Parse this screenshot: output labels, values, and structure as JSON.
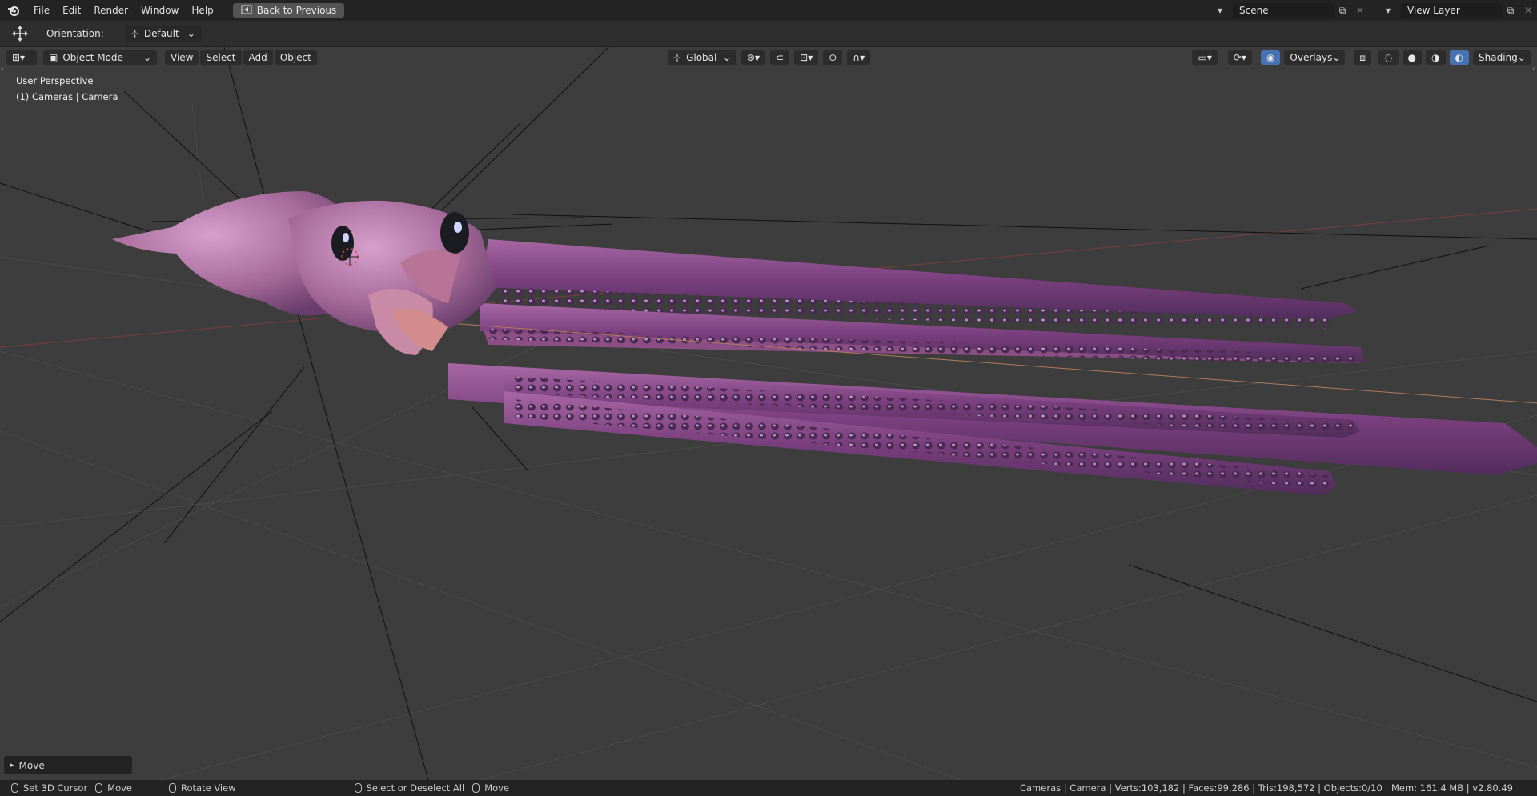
{
  "menu": [
    "File",
    "Edit",
    "Render",
    "Window",
    "Help"
  ],
  "back_button": "Back to Previous",
  "scene": {
    "label": "Scene",
    "view_layer": "View Layer"
  },
  "tool_settings": {
    "orientation_label": "Orientation:",
    "orientation_value": "Default"
  },
  "viewport_header": {
    "mode": "Object Mode",
    "menus": [
      "View",
      "Select",
      "Add",
      "Object"
    ],
    "transform_orientation": "Global",
    "overlays": "Overlays",
    "shading": "Shading"
  },
  "viewport": {
    "perspective": "User Perspective",
    "context": "(1) Cameras | Camera"
  },
  "last_operator": "Move",
  "status": {
    "left": [
      "Set 3D Cursor",
      "Move",
      "Rotate View",
      "Select or Deselect All",
      "Move"
    ],
    "stats": "Cameras | Camera | Verts:103,182 | Faces:99,286 | Tris:198,572 | Objects:0/10 | Mem: 161.4 MB | v2.80.49"
  },
  "colors": {
    "accent": "#4772b3",
    "squid": "#8a4a8a",
    "grid": "#4a4a4a",
    "x_axis": "#8a3a3a"
  }
}
